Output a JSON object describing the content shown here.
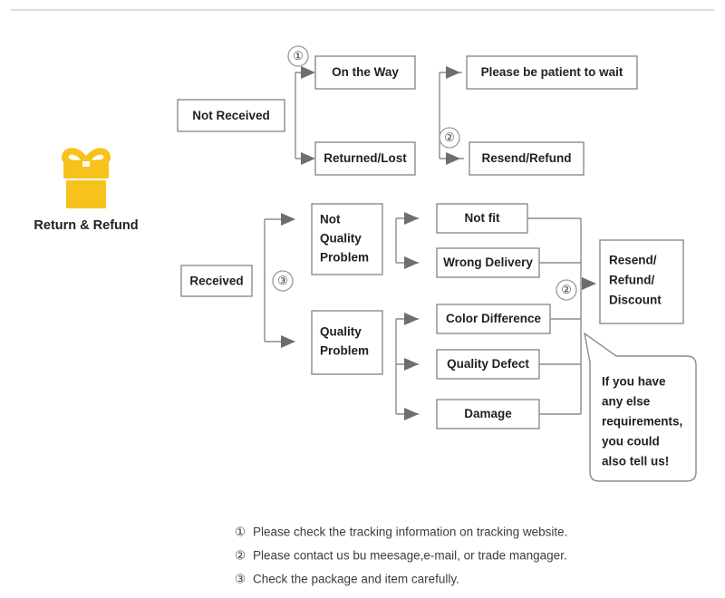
{
  "page": {
    "title": "Return & Refund",
    "accent_color": "#f7c21c",
    "line_color": "#8c8c8c",
    "text_color": "#231f20",
    "background": "#ffffff",
    "rule_color": "#dcdcdc"
  },
  "icon": {
    "name": "gift-box-icon",
    "caption": "Return & Refund",
    "color": "#f7c21c"
  },
  "flow": {
    "not_received": {
      "label": "Not Received",
      "marker_1": "①",
      "marker_2": "②",
      "branches": [
        {
          "label": "On the Way",
          "result": "Please be patient to wait"
        },
        {
          "label": "Returned/Lost",
          "result": "Resend/Refund"
        }
      ]
    },
    "received": {
      "label": "Received",
      "marker_3": "③",
      "marker_2": "②",
      "groups": [
        {
          "label_lines": [
            "Not",
            "Quality",
            "Problem"
          ],
          "reasons": [
            "Not fit",
            "Wrong Delivery"
          ]
        },
        {
          "label_lines": [
            "Quality",
            "Problem"
          ],
          "reasons": [
            "Color Difference",
            "Quality Defect",
            "Damage"
          ]
        }
      ],
      "outcome_lines": [
        "Resend/",
        "Refund/",
        "Discount"
      ]
    }
  },
  "bubble": {
    "lines": [
      "If you have",
      "any else",
      "requirements,",
      "you could",
      "also tell us!"
    ]
  },
  "notes": [
    {
      "marker": "①",
      "text": "Please check the tracking information on tracking website."
    },
    {
      "marker": "②",
      "text": "Please contact us bu meesage,e-mail, or trade mangager."
    },
    {
      "marker": "③",
      "text": "Check the package and item carefully."
    }
  ]
}
